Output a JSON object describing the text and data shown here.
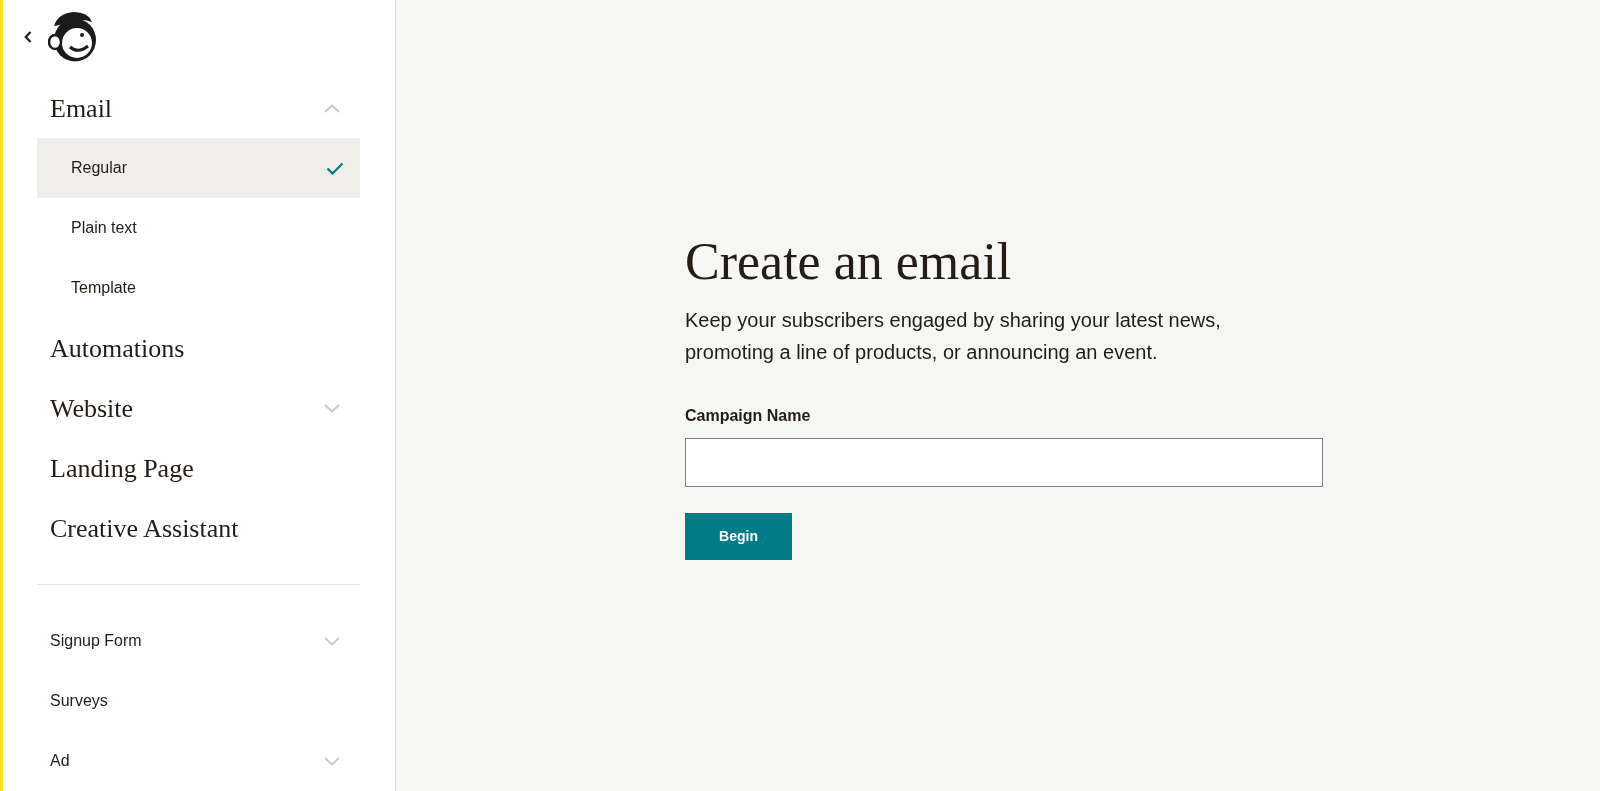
{
  "sidebar": {
    "primary_items": [
      {
        "kind": "section",
        "label": "Email",
        "expanded": true,
        "children": [
          {
            "label": "Regular",
            "selected": true
          },
          {
            "label": "Plain text",
            "selected": false
          },
          {
            "label": "Template",
            "selected": false
          }
        ]
      },
      {
        "kind": "link",
        "label": "Automations"
      },
      {
        "kind": "section",
        "label": "Website",
        "expanded": false
      },
      {
        "kind": "link",
        "label": "Landing Page"
      },
      {
        "kind": "link",
        "label": "Creative Assistant"
      }
    ],
    "secondary_items": [
      {
        "kind": "section",
        "label": "Signup Form",
        "expanded": false
      },
      {
        "kind": "link",
        "label": "Surveys"
      },
      {
        "kind": "section",
        "label": "Ad",
        "expanded": false
      }
    ]
  },
  "main": {
    "title": "Create an email",
    "description": "Keep your subscribers engaged by sharing your latest news, promoting a line of products, or announcing an event.",
    "field": {
      "label": "Campaign Name"
    },
    "button": "Begin"
  }
}
